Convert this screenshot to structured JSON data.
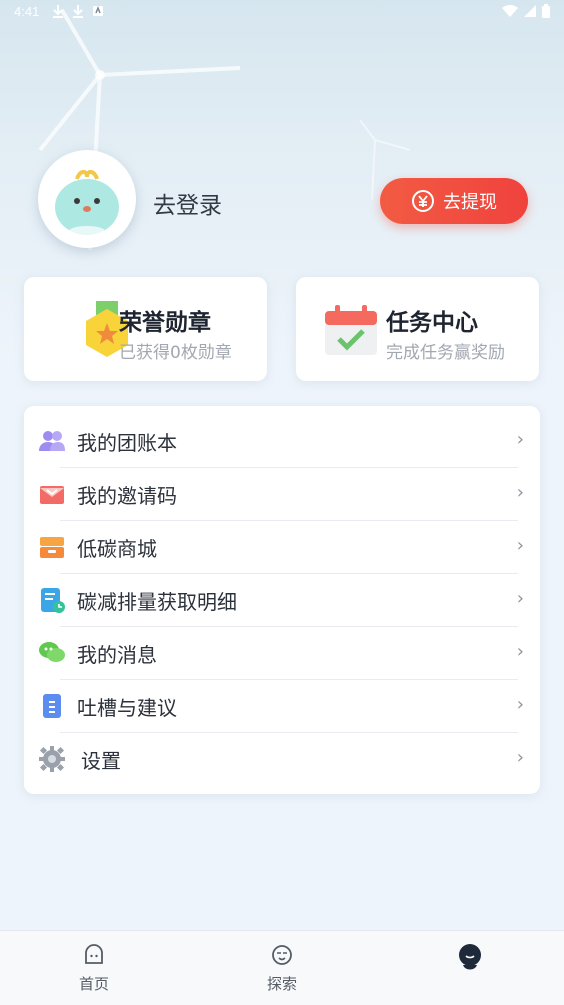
{
  "status_bar": {
    "time": "4:41"
  },
  "profile": {
    "login_label": "去登录",
    "withdraw_label": "去提现"
  },
  "cards": {
    "honor": {
      "title": "荣誉勋章",
      "subtitle": "已获得0枚勋章"
    },
    "tasks": {
      "title": "任务中心",
      "subtitle": "完成任务赢奖励"
    }
  },
  "menu": {
    "items": [
      {
        "label": "我的团账本",
        "icon": "group-icon"
      },
      {
        "label": "我的邀请码",
        "icon": "envelope-icon"
      },
      {
        "label": "低碳商城",
        "icon": "store-icon"
      },
      {
        "label": "碳减排量获取明细",
        "icon": "record-icon"
      },
      {
        "label": "我的消息",
        "icon": "chat-icon"
      },
      {
        "label": "吐槽与建议",
        "icon": "document-icon"
      },
      {
        "label": "设置",
        "icon": "gear-icon"
      }
    ],
    "chevron": "›"
  },
  "tabbar": {
    "tabs": [
      {
        "label": "首页",
        "icon": "home-face-icon"
      },
      {
        "label": "探索",
        "icon": "explore-face-icon"
      },
      {
        "label": "",
        "icon": "mine-avatar-icon"
      }
    ]
  },
  "colors": {
    "accent_red": "#f0423d",
    "background": "#eef4fb"
  }
}
